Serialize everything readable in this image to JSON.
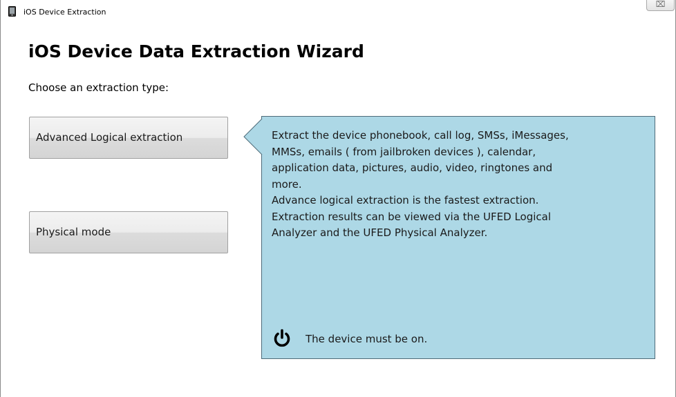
{
  "window": {
    "title": "iOS Device Extraction",
    "app_icon": "phone-icon",
    "close_icon": "close-icon",
    "close_glyph": "⌧"
  },
  "wizard": {
    "heading": "iOS Device Data Extraction Wizard",
    "prompt": "Choose an extraction type:"
  },
  "options": [
    {
      "label": "Advanced Logical extraction",
      "selected": true
    },
    {
      "label": "Physical mode",
      "selected": false
    }
  ],
  "info": {
    "lines": [
      "Extract the device phonebook, call log, SMSs, iMessages,",
      "MMSs, emails ( from jailbroken devices ), calendar,",
      "application data, pictures, audio, video, ringtones  and",
      "more.",
      "Advance logical extraction is the fastest extraction.",
      "Extraction results can be viewed via the UFED Logical",
      "Analyzer and the UFED Physical Analyzer."
    ],
    "note_icon": "power-icon",
    "note": "The device must be on."
  },
  "colors": {
    "info_panel_bg": "#add8e6",
    "info_panel_border": "#4d6a78"
  }
}
